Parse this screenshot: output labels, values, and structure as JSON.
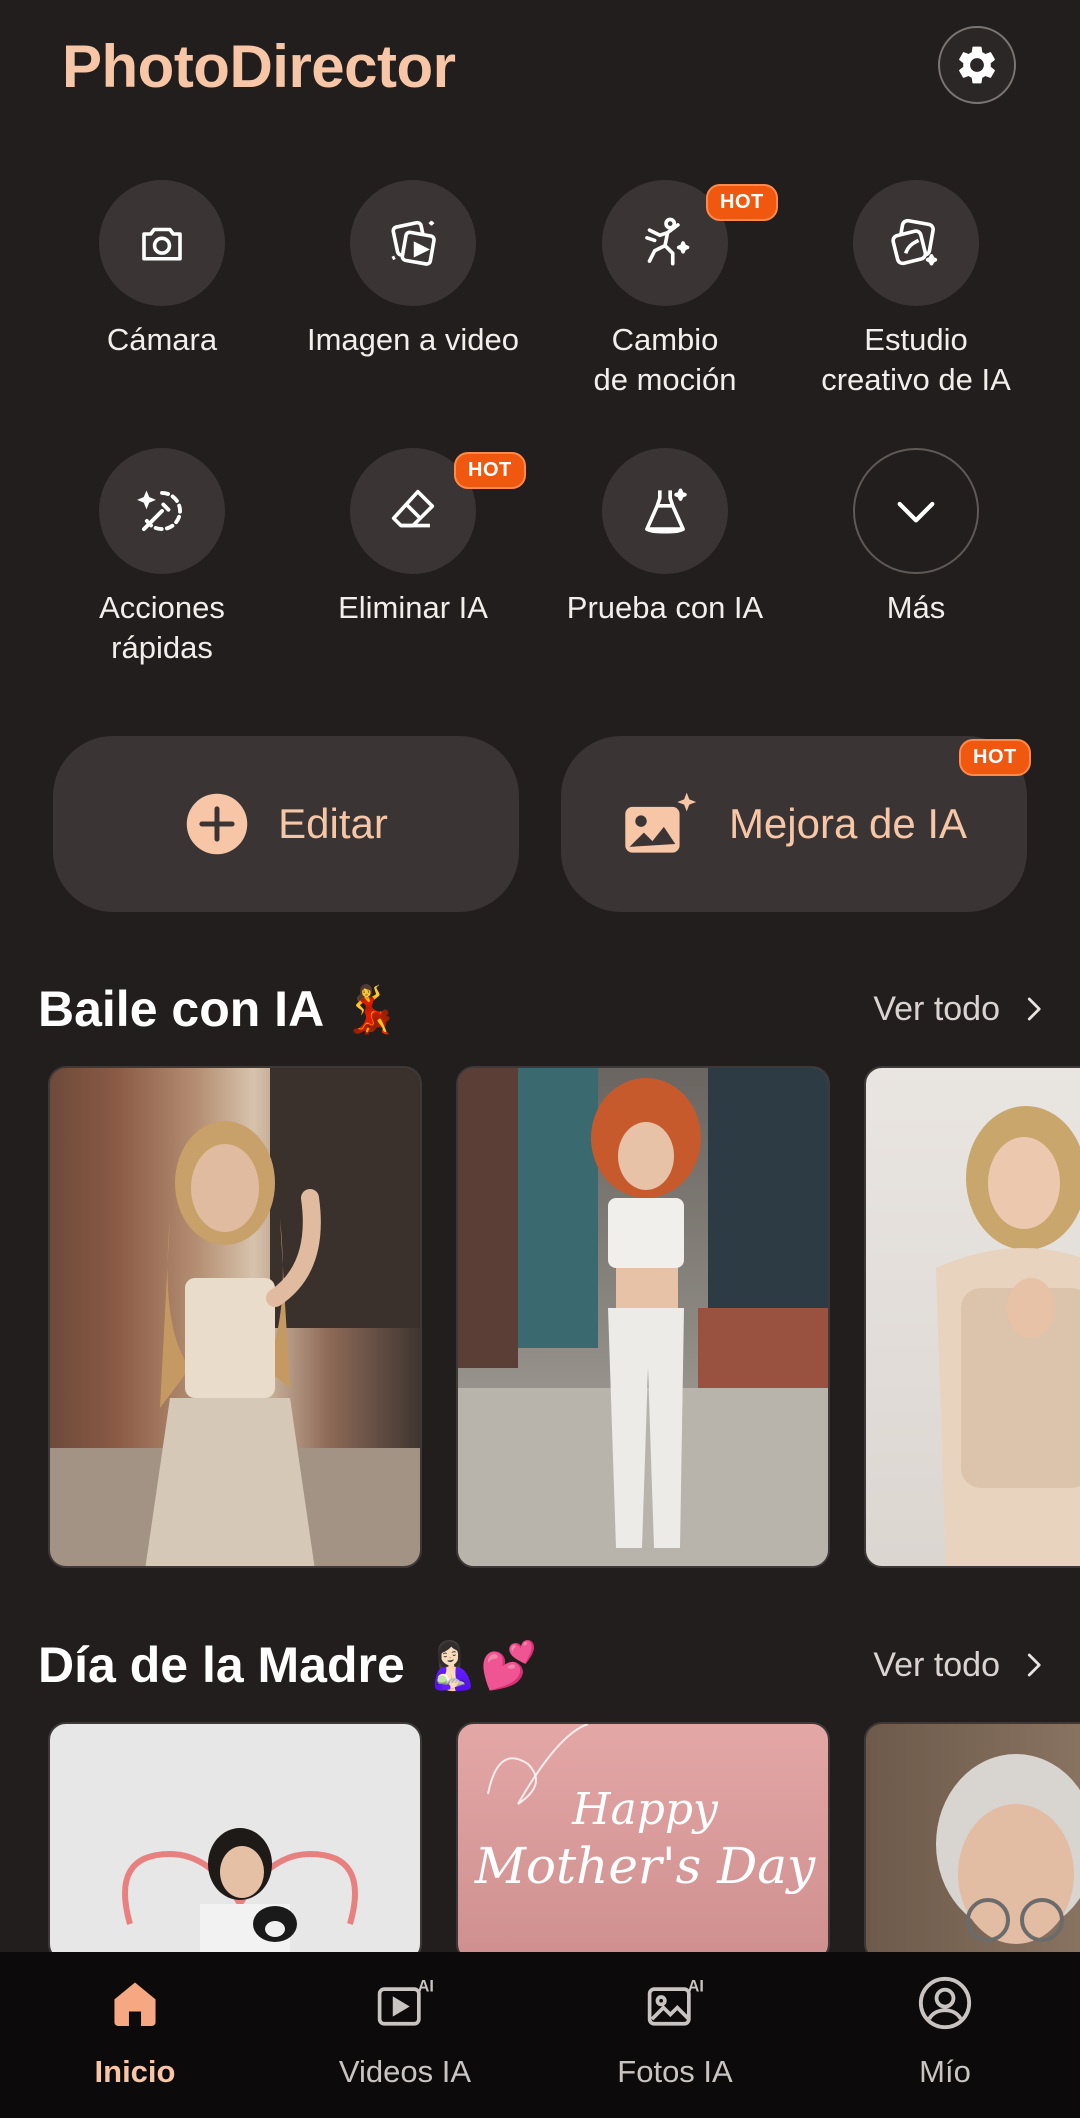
{
  "header": {
    "title": "PhotoDirector"
  },
  "tools": [
    {
      "label": "Cámara",
      "icon": "camera-icon",
      "hot": false
    },
    {
      "label": "Imagen a video",
      "icon": "image-to-video-icon",
      "hot": false
    },
    {
      "label": "Cambio\nde moción",
      "icon": "motion-dancer-icon",
      "hot": true
    },
    {
      "label": "Estudio\ncreativo de IA",
      "icon": "creative-studio-icon",
      "hot": false
    },
    {
      "label": "Acciones\nrápidas",
      "icon": "magic-wand-icon",
      "hot": false
    },
    {
      "label": "Eliminar IA",
      "icon": "eraser-icon",
      "hot": true
    },
    {
      "label": "Prueba con IA",
      "icon": "dress-icon",
      "hot": false
    },
    {
      "label": "Más",
      "icon": "chevron-down-icon",
      "hot": false
    }
  ],
  "hot_label": "HOT",
  "actions": {
    "edit_label": "Editar",
    "enhance_label": "Mejora de IA"
  },
  "sections": {
    "dance": {
      "title": "Baile con IA",
      "emoji": "💃",
      "see_all": "Ver todo"
    },
    "mother": {
      "title": "Día de la Madre",
      "emoji": "🤱🏻💕",
      "see_all": "Ver todo"
    }
  },
  "cards": {
    "mother_day_text_1": "Happy",
    "mother_day_text_2": "Mother's Day"
  },
  "bottom_nav": [
    {
      "label": "Inicio",
      "icon": "home-icon",
      "active": true
    },
    {
      "label": "Videos IA",
      "icon": "ai-video-icon",
      "active": false
    },
    {
      "label": "Fotos IA",
      "icon": "ai-photo-icon",
      "active": false
    },
    {
      "label": "Mío",
      "icon": "profile-icon",
      "active": false
    }
  ],
  "colors": {
    "accent": "#f6c6a6",
    "hot_badge": "#f0570f",
    "background": "#221e1d"
  }
}
